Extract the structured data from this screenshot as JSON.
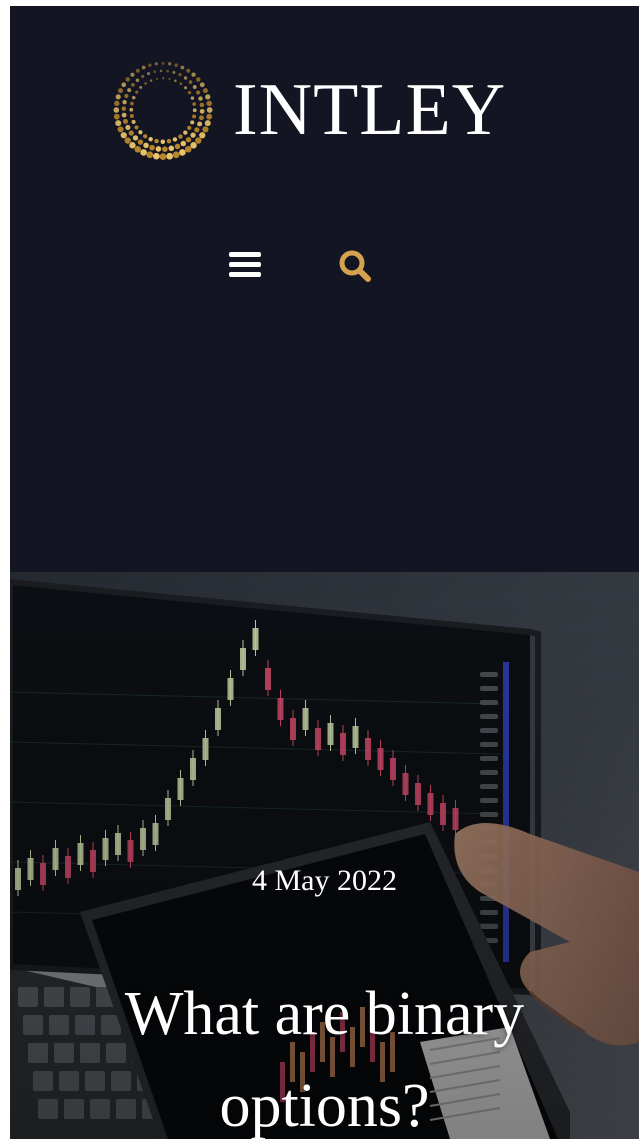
{
  "brand": {
    "name": "INTLEY",
    "logo_icon": "dotted-circle-logo-icon",
    "text_color": "#ffffff",
    "mark_colors": [
      "#e9c46a",
      "#b8862b"
    ]
  },
  "header": {
    "background": "#131522",
    "menu_icon": "hamburger-menu-icon",
    "search_icon": "search-icon",
    "search_color": "#d4a24c"
  },
  "hero": {
    "date": "4 May 2022",
    "title": "What are binary options?",
    "image": "trading-chart-laptop-tablet-photo"
  }
}
